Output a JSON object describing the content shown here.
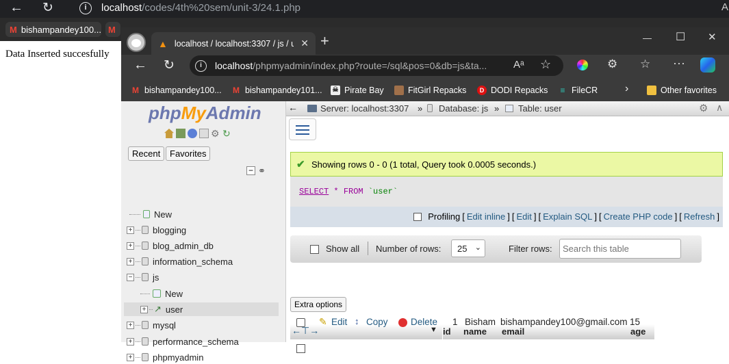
{
  "back_browser": {
    "url_host": "localhost",
    "url_path": "/codes/4th%20sem/unit-3/24.1.php",
    "toolbar_right_glyph": "A",
    "tabs": [
      {
        "label": "bishampandey100..."
      },
      {
        "label": ""
      }
    ],
    "page_text": "Data Inserted succesfully"
  },
  "front_browser": {
    "tab_title": "localhost / localhost:3307 / js / u",
    "url_host": "localhost",
    "url_path": "/phpmyadmin/index.php?route=/sql&pos=0&db=js&ta...",
    "read_aloud_glyph": "Aᵃ",
    "favorites": [
      {
        "label": "bishampandey100...",
        "icon": "gmail-icon"
      },
      {
        "label": "bishampandey101...",
        "icon": "gmail-icon"
      },
      {
        "label": "Pirate Bay",
        "icon": "pirate-bay-icon"
      },
      {
        "label": "FitGirl Repacks",
        "icon": "fitgirl-icon"
      },
      {
        "label": "DODI Repacks",
        "icon": "dodi-icon"
      },
      {
        "label": "FileCR",
        "icon": "filecr-icon"
      }
    ],
    "other_favorites": "Other favorites",
    "window_controls": {
      "minimize": "—",
      "maximize": "☐",
      "close": "✕"
    }
  },
  "phpmyadmin": {
    "logo_php": "php",
    "logo_my": "My",
    "logo_admin": "Admin",
    "side_tabs": {
      "recent": "Recent",
      "favorites": "Favorites"
    },
    "tree": [
      {
        "label": "New",
        "level": 0,
        "type": "new"
      },
      {
        "label": "blogging",
        "level": 0,
        "type": "db"
      },
      {
        "label": "blog_admin_db",
        "level": 0,
        "type": "db"
      },
      {
        "label": "information_schema",
        "level": 0,
        "type": "db"
      },
      {
        "label": "js",
        "level": 0,
        "type": "db-open"
      },
      {
        "label": "New",
        "level": 1,
        "type": "new"
      },
      {
        "label": "user",
        "level": 1,
        "type": "table"
      },
      {
        "label": "mysql",
        "level": 0,
        "type": "db"
      },
      {
        "label": "performance_schema",
        "level": 0,
        "type": "db"
      },
      {
        "label": "phpmyadmin",
        "level": 0,
        "type": "db"
      }
    ],
    "breadcrumb": {
      "server": "Server: localhost:3307",
      "database": "Database: js",
      "table": "Table: user"
    },
    "success_message": "Showing rows 0 - 0 (1 total, Query took 0.0005 seconds.)",
    "sql": {
      "kw1": "SELECT",
      "star": "*",
      "kw2": "FROM",
      "table": "`user`"
    },
    "profiling": {
      "label": "Profiling",
      "links": [
        "Edit inline",
        "Edit",
        "Explain SQL",
        "Create PHP code",
        "Refresh"
      ]
    },
    "controls": {
      "show_all": "Show all",
      "rows_label": "Number of rows:",
      "rows_value": "25",
      "filter_label": "Filter rows:",
      "filter_placeholder": "Search this table"
    },
    "extra_options": "Extra options",
    "table": {
      "columns": [
        "id",
        "name",
        "email",
        "age"
      ],
      "rows": [
        {
          "edit": "Edit",
          "copy": "Copy",
          "delete": "Delete",
          "id": "1",
          "name": "Bisham",
          "email": "bishampandey100@gmail.com",
          "age": "15"
        }
      ]
    }
  }
}
